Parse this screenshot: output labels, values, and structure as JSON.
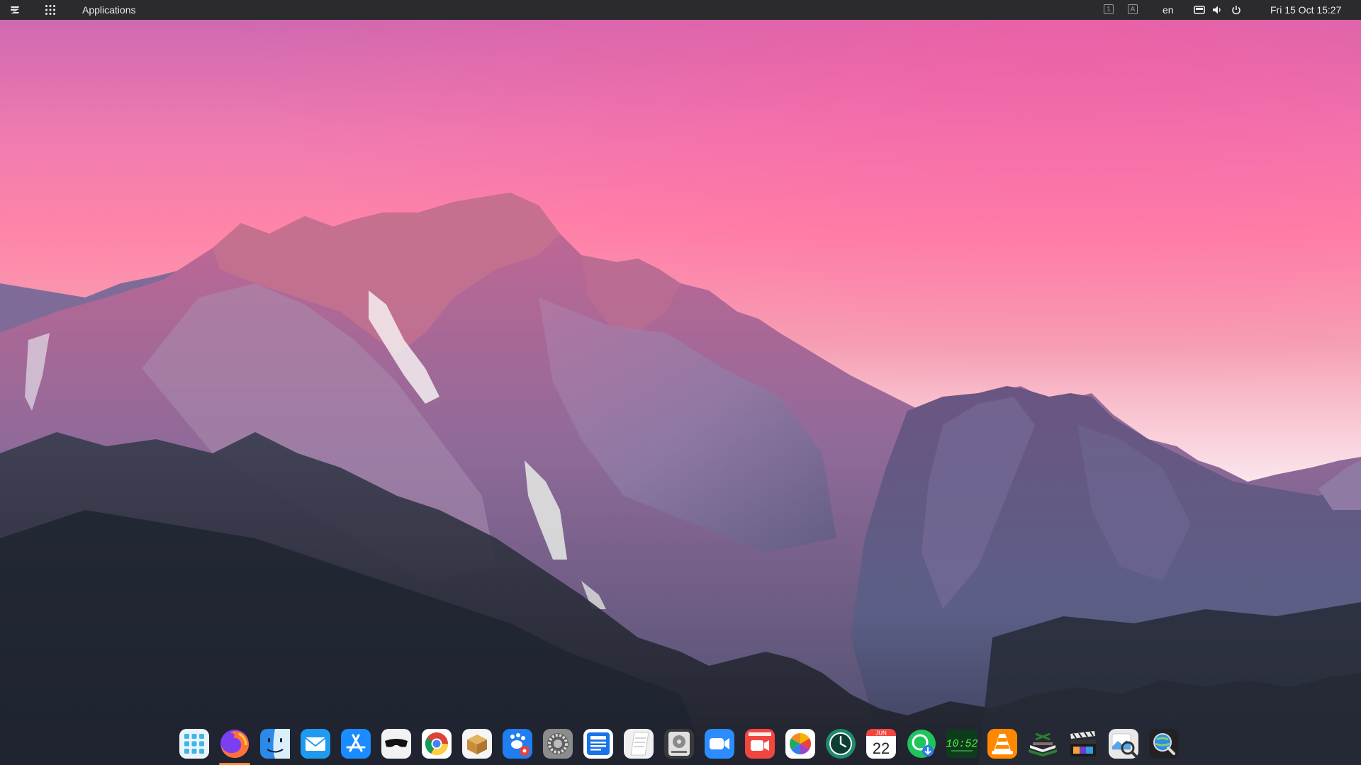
{
  "top_panel": {
    "apps_label": "Applications",
    "workspaces": [
      "1",
      "A"
    ],
    "language": "en",
    "clock": "Fri 15 Oct  15:27",
    "icons": [
      "zorin-logo-icon",
      "app-grid-icon",
      "keyboard-icon",
      "volume-icon",
      "power-icon"
    ]
  },
  "dock": {
    "items": [
      {
        "name": "launchpad",
        "icon": "launchpad-grid-icon",
        "color": "#3fb6e8"
      },
      {
        "name": "firefox",
        "icon": "firefox-icon",
        "color": "#ff7139",
        "running": true
      },
      {
        "name": "finder",
        "icon": "finder-face-icon",
        "color": "#2b8ae8"
      },
      {
        "name": "mail",
        "icon": "mail-envelope-icon",
        "color": "#1e9bf0"
      },
      {
        "name": "app-store",
        "icon": "app-store-icon",
        "color": "#1a8cff"
      },
      {
        "name": "privacy",
        "icon": "mask-icon",
        "color": "#f2f2f2"
      },
      {
        "name": "chrome",
        "icon": "chrome-icon",
        "color": "#ffffff"
      },
      {
        "name": "archive",
        "icon": "package-icon",
        "color": "#f5f5f5"
      },
      {
        "name": "gimp",
        "icon": "paw-settings-icon",
        "color": "#1f7ef0"
      },
      {
        "name": "system-preferences",
        "icon": "gear-icon",
        "color": "#8c8c8c"
      },
      {
        "name": "text-editor",
        "icon": "document-icon",
        "color": "#1a73e8"
      },
      {
        "name": "notes",
        "icon": "notepad-icon",
        "color": "#f0f0f0"
      },
      {
        "name": "disk-utility",
        "icon": "disk-icon",
        "color": "#3a3a3a"
      },
      {
        "name": "zoom",
        "icon": "video-camera-icon",
        "color": "#2d8cff"
      },
      {
        "name": "screen-recorder",
        "icon": "record-camera-icon",
        "color": "#f2473f"
      },
      {
        "name": "photos",
        "icon": "photo-icon",
        "color": "#ffffff"
      },
      {
        "name": "time-machine",
        "icon": "clock-icon",
        "color": "#1e8a6e"
      },
      {
        "name": "calendar",
        "icon": "calendar-icon",
        "color": "#ffffff",
        "month": "JUN",
        "day": "22"
      },
      {
        "name": "downloader",
        "icon": "download-icon",
        "color": "#21c45c"
      },
      {
        "name": "desktop-clock",
        "icon": "digital-clock-icon",
        "color": "#0f3b1d",
        "time": "10:52"
      },
      {
        "name": "vlc",
        "icon": "vlc-cone-icon",
        "color": "#ff8800"
      },
      {
        "name": "reader",
        "icon": "book-icon",
        "color": "#2e7d32"
      },
      {
        "name": "video-editor",
        "icon": "clapperboard-icon",
        "color": "#1c1c1c"
      },
      {
        "name": "image-viewer",
        "icon": "magnifier-icon",
        "color": "#e8e8e8"
      },
      {
        "name": "web-browser",
        "icon": "globe-search-icon",
        "color": "#222222"
      }
    ]
  }
}
